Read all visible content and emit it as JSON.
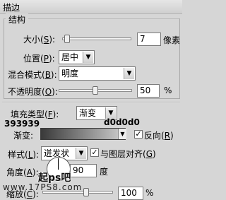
{
  "title": "描边",
  "structure": {
    "group_label": "结构",
    "size_label": "大小(",
    "size_key": "S",
    "size_end": "):",
    "size_value": "7",
    "size_unit": "像素",
    "size_slider_fraction": 0.05,
    "position_label": "位置(",
    "position_key": "P",
    "position_end": "):",
    "position_value": "居中",
    "blend_label": "混合模式(",
    "blend_key": "B",
    "blend_end": "):",
    "blend_value": "明度",
    "opacity_label": "不透明度(",
    "opacity_key": "O",
    "opacity_end": "):",
    "opacity_value": "50",
    "opacity_unit": "%",
    "opacity_slider_fraction": 0.5
  },
  "fill": {
    "type_label": "填充类型(",
    "type_key": "F",
    "type_end": "):",
    "type_value": "渐变",
    "color_start": "393939",
    "color_end": "d0d0d0",
    "gradient_label": "渐变:",
    "reverse_label": "反向(",
    "reverse_key": "R",
    "reverse_end": ")",
    "reverse_checked": "✓",
    "style_label": "样式(",
    "style_key": "L",
    "style_end": "):",
    "style_value": "迸发状",
    "align_label": "与图层对齐(",
    "align_key": "G",
    "align_end": ")",
    "align_checked": "✓",
    "angle_label": "角度(",
    "angle_key": "A",
    "angle_end": "):",
    "angle_value": "90",
    "angle_unit": "度",
    "scale_label": "缩放(",
    "scale_key": "C",
    "scale_end": "):",
    "scale_value": "100",
    "scale_unit": "%",
    "scale_slider_fraction": 0.5
  },
  "watermark": {
    "line1": "起ps吧",
    "line2": "www.17PS8.com"
  }
}
